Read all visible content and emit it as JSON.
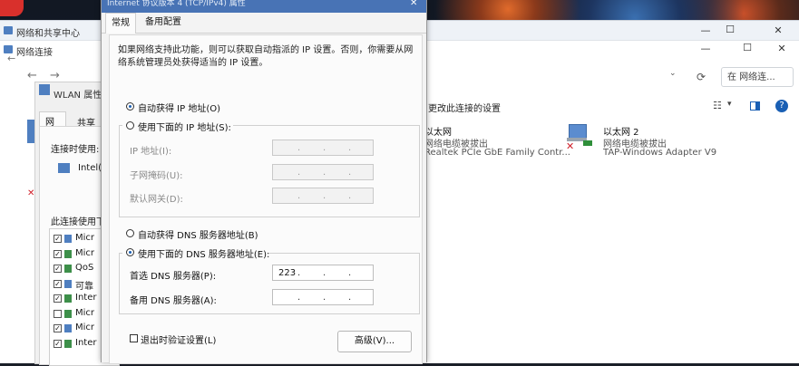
{
  "back_window": {
    "title": "网络和共享中心"
  },
  "network_connections": {
    "title": "网络连接",
    "controls": {
      "minimize": "—",
      "maximize": "☐",
      "close": "✕"
    },
    "search_placeholder": "在 网络连...",
    "toolbar": {
      "change_settings": "更改此连接的设置"
    },
    "adapters": [
      {
        "name": "以太网",
        "status": "网络电缆被拔出",
        "device": "Realtek PCIe GbE Family Contr..."
      },
      {
        "name": "以太网 2",
        "status": "网络电缆被拔出",
        "device": "TAP-Windows Adapter V9"
      }
    ]
  },
  "wlan_dialog": {
    "title": "WLAN 属性",
    "tabs": [
      "网络",
      "共享"
    ],
    "connect_using_label": "连接时使用:",
    "adapter_name": "Intel(R",
    "items_label": "此连接使用下",
    "items": [
      {
        "label": "Micr",
        "checked": true
      },
      {
        "label": "Micr",
        "checked": true
      },
      {
        "label": "QoS",
        "checked": true
      },
      {
        "label": "可靠",
        "checked": true
      },
      {
        "label": "Inter",
        "checked": true
      },
      {
        "label": "Micr",
        "checked": false
      },
      {
        "label": "Micr",
        "checked": true
      },
      {
        "label": "Inter",
        "checked": true
      }
    ]
  },
  "ipv4_dialog": {
    "title": "Internet 协议版本 4 (TCP/IPv4) 属性",
    "tabs": {
      "general": "常规",
      "alternate": "备用配置"
    },
    "description_line1": "如果网络支持此功能，则可以获取自动指派的 IP 设置。否则，你需要从网",
    "description_line2": "络系统管理员处获得适当的 IP 设置。",
    "auto_ip_label": "自动获得 IP 地址(O)",
    "manual_ip_label": "使用下面的 IP 地址(S):",
    "ip_address_label": "IP 地址(I):",
    "subnet_mask_label": "子网掩码(U):",
    "gateway_label": "默认网关(D):",
    "auto_dns_label": "自动获得 DNS 服务器地址(B)",
    "manual_dns_label": "使用下面的 DNS 服务器地址(E):",
    "preferred_dns_label": "首选 DNS 服务器(P):",
    "preferred_dns_value": "223",
    "alternate_dns_label": "备用 DNS 服务器(A):",
    "validate_label": "退出时验证设置(L)",
    "advanced_button": "高级(V)..."
  }
}
